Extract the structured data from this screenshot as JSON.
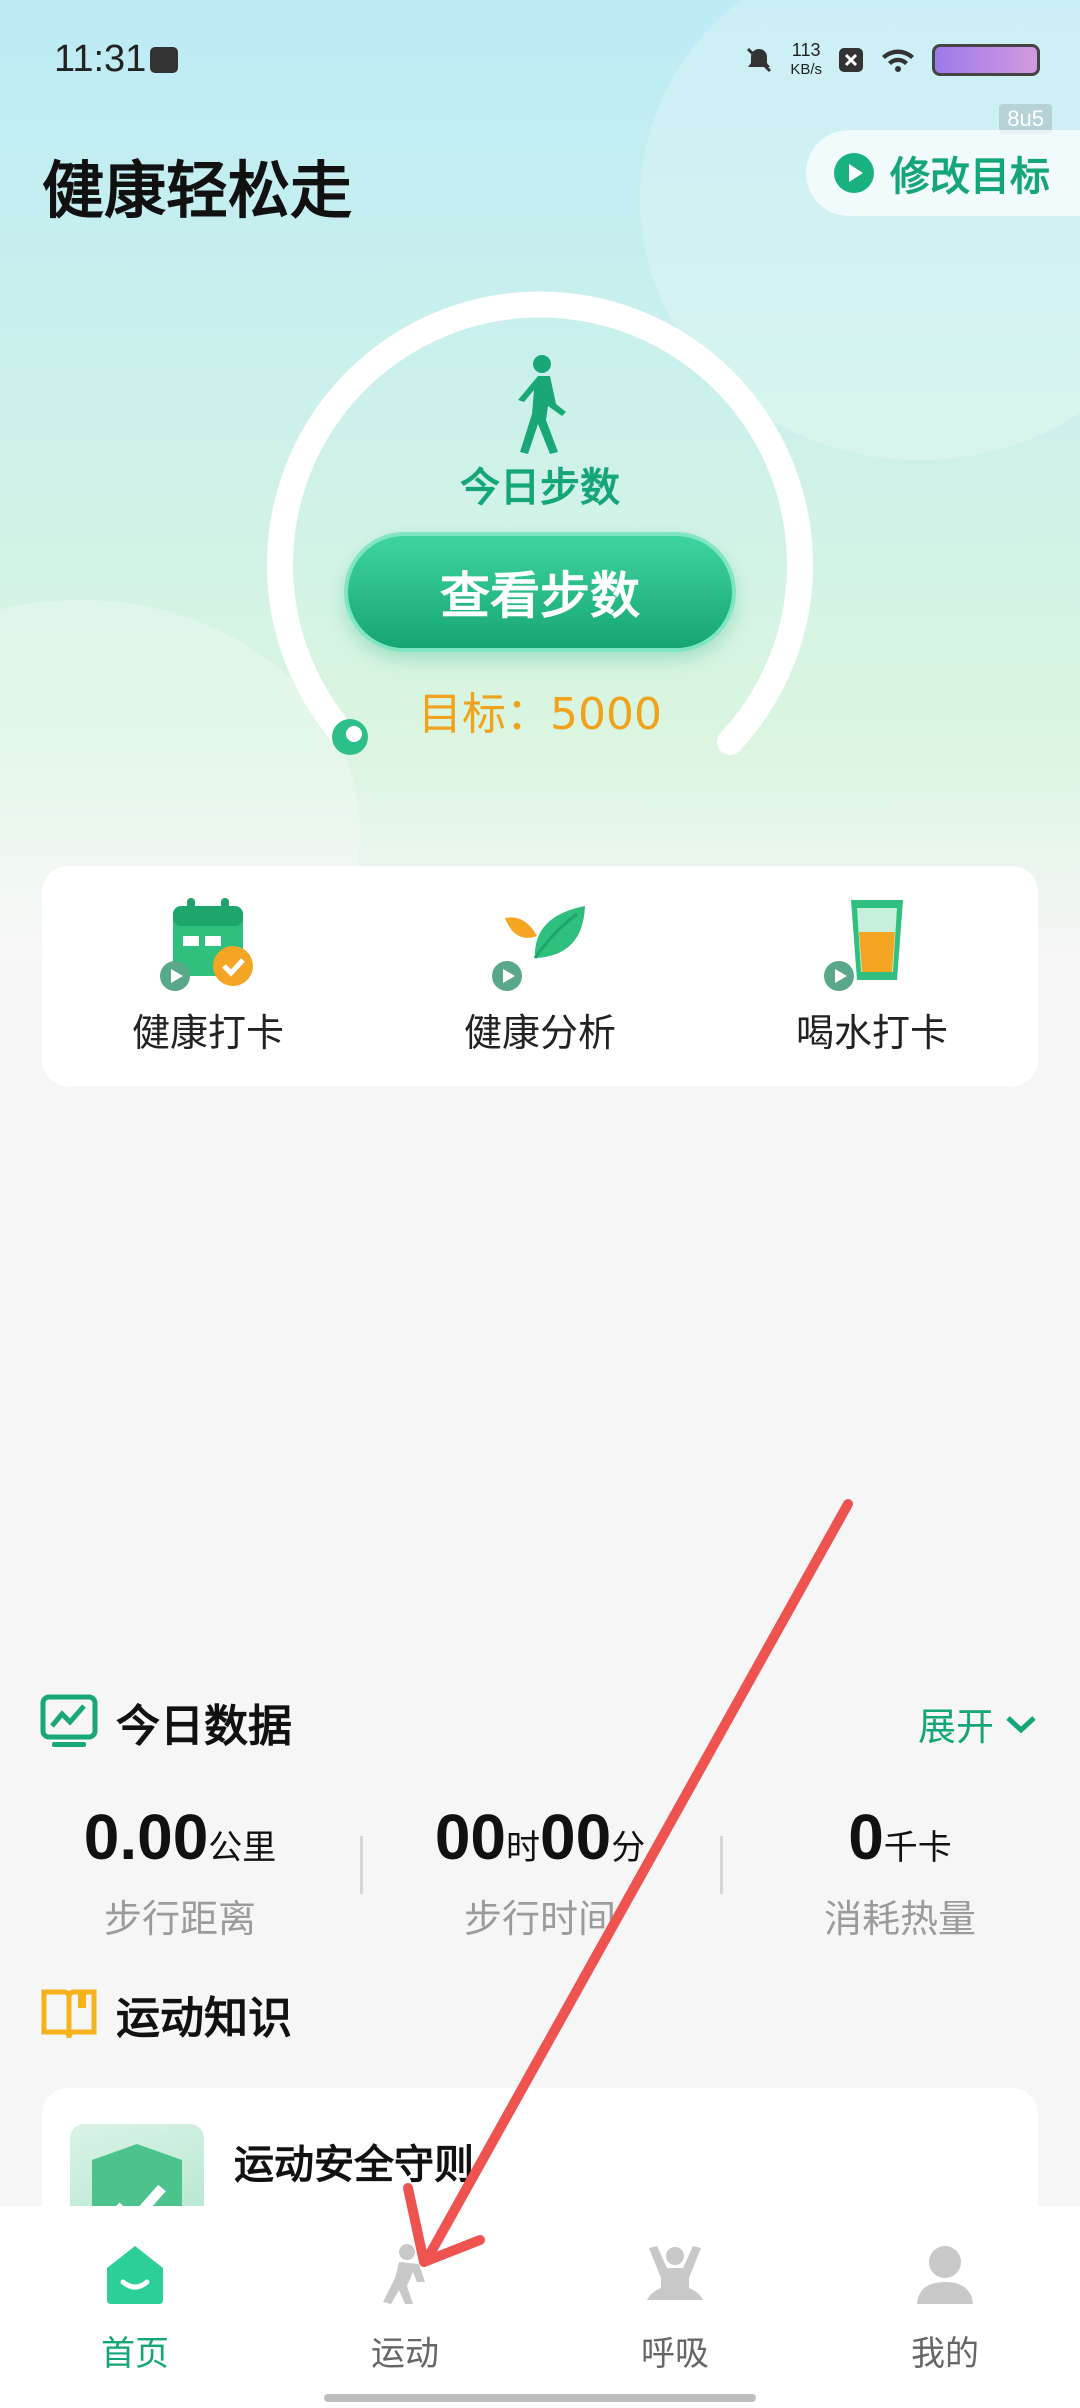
{
  "status_bar": {
    "time": "11:31",
    "speed_value": "113",
    "speed_unit": "KB/s",
    "tag": "8u5"
  },
  "header": {
    "title": "健康轻松走",
    "goal_button": "修改目标"
  },
  "steps": {
    "label": "今日步数",
    "button": "查看步数",
    "target": "目标：5000"
  },
  "quick_actions": [
    {
      "label": "健康打卡",
      "icon": "calendar-check-icon"
    },
    {
      "label": "健康分析",
      "icon": "leaf-icon"
    },
    {
      "label": "喝水打卡",
      "icon": "water-cup-icon"
    }
  ],
  "today_data": {
    "title": "今日数据",
    "expand": "展开",
    "distance": {
      "value": "0.00",
      "unit": "公里",
      "label": "步行距离"
    },
    "time": {
      "hours": "00",
      "hours_unit": "时",
      "minutes": "00",
      "minutes_unit": "分",
      "label": "步行时间"
    },
    "calories": {
      "value": "0",
      "unit": "千卡",
      "label": "消耗热量"
    }
  },
  "knowledge": {
    "title": "运动知识",
    "items": [
      {
        "title": "运动安全守则"
      }
    ]
  },
  "tabs": [
    {
      "label": "首页",
      "icon": "home-icon",
      "active": true
    },
    {
      "label": "运动",
      "icon": "exercise-icon",
      "active": false
    },
    {
      "label": "呼吸",
      "icon": "breath-icon",
      "active": false
    },
    {
      "label": "我的",
      "icon": "profile-icon",
      "active": false
    }
  ],
  "colors": {
    "accent": "#14a578",
    "target": "#f0a21d",
    "annotation_arrow": "#ef5350"
  }
}
